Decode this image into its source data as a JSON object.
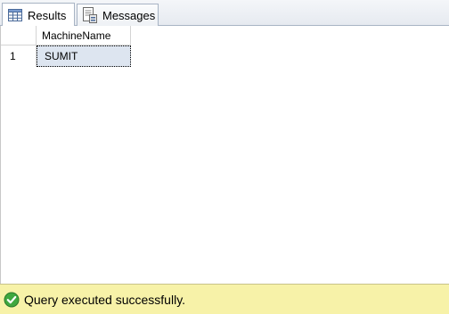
{
  "tabs": {
    "results_label": "Results",
    "messages_label": "Messages"
  },
  "grid": {
    "columns": [
      "MachineName"
    ],
    "rows": [
      {
        "row_number": "1",
        "cells": [
          "SUMIT"
        ]
      }
    ]
  },
  "status": {
    "message": "Query executed successfully.",
    "icon": "check-circle-icon",
    "background_color": "#f7f2a8"
  }
}
